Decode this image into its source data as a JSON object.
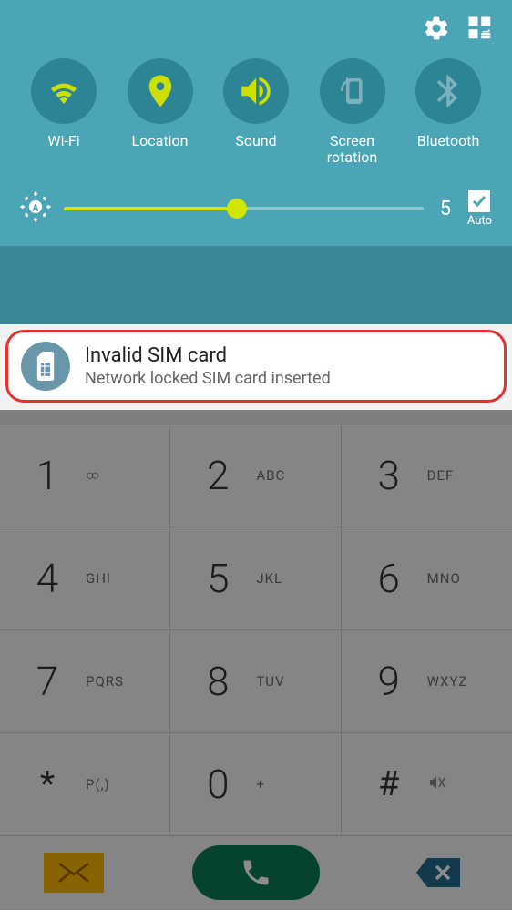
{
  "toggles": {
    "wifi": "Wi-Fi",
    "location": "Location",
    "sound": "Sound",
    "rotation": "Screen\nrotation",
    "bluetooth": "Bluetooth"
  },
  "brightness": {
    "value": "5",
    "auto_label": "Auto"
  },
  "notification": {
    "title": "Invalid SIM card",
    "body": "Network locked SIM card inserted"
  },
  "keypad": [
    {
      "digit": "1",
      "letters": ""
    },
    {
      "digit": "2",
      "letters": "ABC"
    },
    {
      "digit": "3",
      "letters": "DEF"
    },
    {
      "digit": "4",
      "letters": "GHI"
    },
    {
      "digit": "5",
      "letters": "JKL"
    },
    {
      "digit": "6",
      "letters": "MNO"
    },
    {
      "digit": "7",
      "letters": "PQRS"
    },
    {
      "digit": "8",
      "letters": "TUV"
    },
    {
      "digit": "9",
      "letters": "WXYZ"
    },
    {
      "digit": "*",
      "letters": "P(,)"
    },
    {
      "digit": "0",
      "letters": "+"
    },
    {
      "digit": "#",
      "letters": ""
    }
  ]
}
